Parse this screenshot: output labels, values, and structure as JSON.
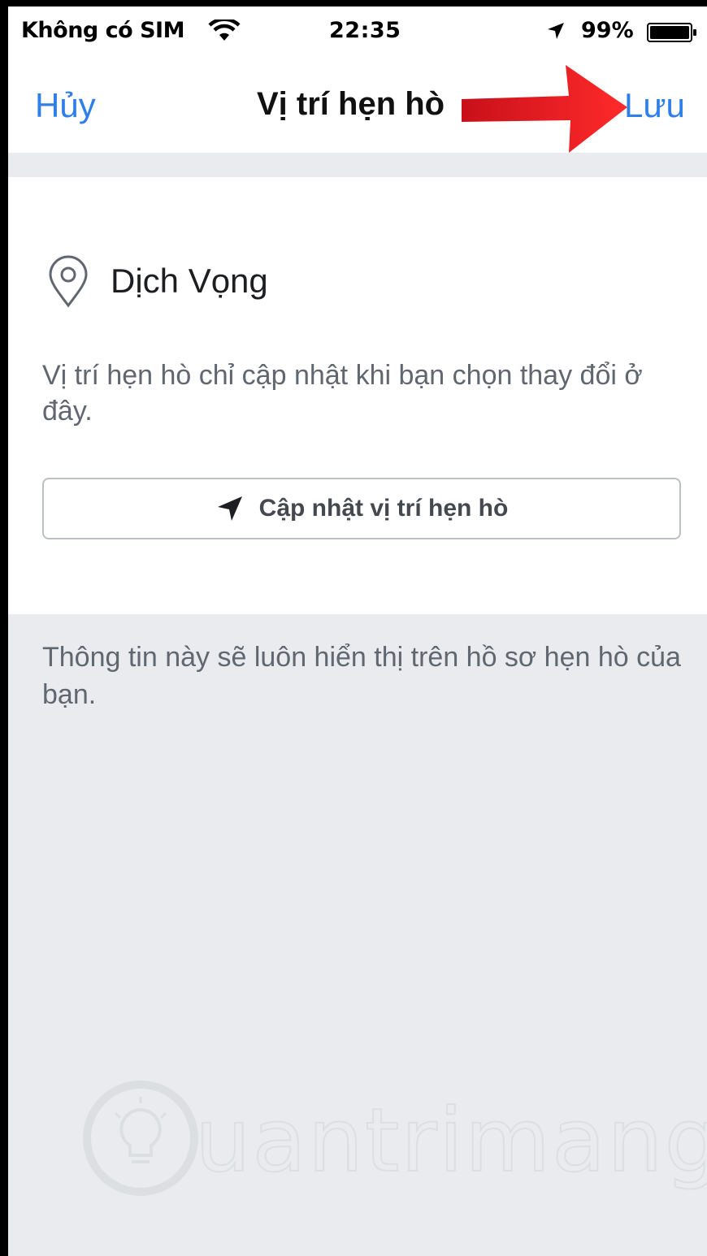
{
  "status_bar": {
    "carrier": "Không có SIM",
    "time": "22:35",
    "battery": "99%"
  },
  "nav": {
    "cancel_label": "Hủy",
    "title": "Vị trí hẹn hò",
    "save_label": "Lưu"
  },
  "location": {
    "place_name": "Dịch Vọng",
    "description": "Vị trí hẹn hò chỉ cập nhật khi bạn chọn thay đổi ở đây.",
    "update_button_label": "Cập nhật vị trí hẹn hò"
  },
  "footer_info": "Thông tin này sẽ luôn hiển thị trên hồ sơ hẹn hò của bạn.",
  "watermark": {
    "text": "uantrimang",
    "logo": "Quantrimang"
  },
  "colors": {
    "accent_blue": "#2f7fe8",
    "annotation_arrow": "#ee1c24",
    "section_background": "#e9ebee"
  },
  "icons": {
    "wifi": "wifi-icon",
    "location_arrow": "location-arrow-icon",
    "battery": "battery-icon",
    "pin": "map-pin-icon"
  }
}
